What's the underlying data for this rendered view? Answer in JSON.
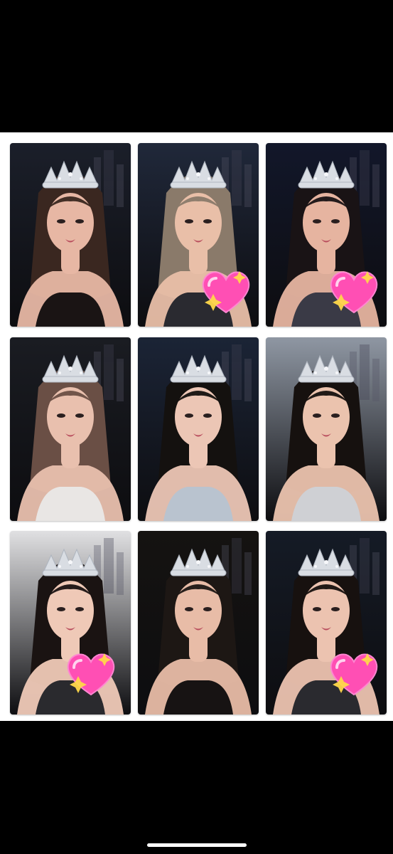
{
  "grid": {
    "cards": [
      {
        "name": "photocard-1",
        "bg": "#1b1f2a",
        "skin": "#e7b7a4",
        "hair": "#3a2720",
        "dress": "#1a1414",
        "sticker": false
      },
      {
        "name": "photocard-2",
        "bg": "#20283a",
        "skin": "#e9bfa8",
        "hair": "#8a7a6a",
        "dress": "#2a2a30",
        "sticker": true
      },
      {
        "name": "photocard-3",
        "bg": "#12172a",
        "skin": "#e6b4a0",
        "hair": "#191315",
        "dress": "#3a3a46",
        "sticker": true
      },
      {
        "name": "photocard-4",
        "bg": "#1a1c22",
        "skin": "#e9c0ae",
        "hair": "#6a4f45",
        "dress": "#e9e6e4",
        "sticker": false
      },
      {
        "name": "photocard-5",
        "bg": "#1b2436",
        "skin": "#ecc6b5",
        "hair": "#14110f",
        "dress": "#b9c3cf",
        "sticker": false
      },
      {
        "name": "photocard-6",
        "bg": "#8f97a3",
        "skin": "#ebc3ae",
        "hair": "#16110f",
        "dress": "#cfd0d4",
        "sticker": false
      },
      {
        "name": "photocard-7",
        "bg": "#e0e0e2",
        "skin": "#efc9b7",
        "hair": "#1a1312",
        "dress": "#2a2a2e",
        "sticker": true
      },
      {
        "name": "photocard-8",
        "bg": "#151311",
        "skin": "#e8bca7",
        "hair": "#1d1714",
        "dress": "#171313",
        "sticker": false
      },
      {
        "name": "photocard-9",
        "bg": "#151b26",
        "skin": "#ecc3b0",
        "hair": "#17110f",
        "dress": "#2a2a2f",
        "sticker": true
      }
    ]
  },
  "colors": {
    "tiara": "#d9dde3",
    "heart": "#ff4fb4",
    "sparkle": "#ffd84a"
  }
}
